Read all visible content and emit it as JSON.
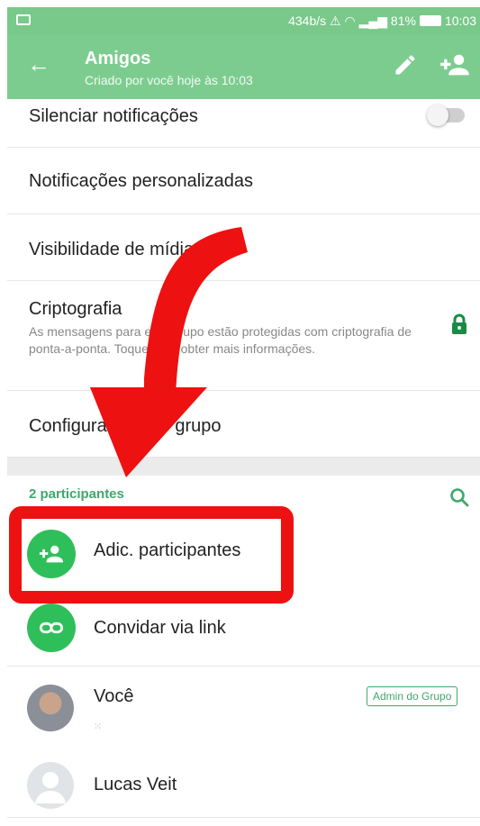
{
  "status_bar": {
    "network_speed": "434b/s",
    "battery": "81%",
    "time": "10:03"
  },
  "app_bar": {
    "title": "Amigos",
    "subtitle": "Criado por você hoje às 10:03"
  },
  "settings": {
    "mute_label": "Silenciar notificações",
    "mute_enabled": false,
    "custom_notifications_label": "Notificações personalizadas",
    "media_visibility_label": "Visibilidade de mídia",
    "encryption_label": "Criptografia",
    "encryption_desc": "As mensagens para este grupo estão protegidas com criptografia de ponta-a-ponta. Toque para obter mais informações.",
    "group_settings_label": "Configurações do grupo"
  },
  "participants": {
    "header": "2 participantes",
    "add_label": "Adic. participantes",
    "invite_label": "Convidar via link",
    "members": [
      {
        "name": "Você",
        "badge": "Admin do Grupo",
        "status": "⁙"
      },
      {
        "name": "Lucas Veit"
      }
    ]
  },
  "colors": {
    "appbar": "#7dcc8f",
    "accent": "#2fbf5a",
    "highlight": "#ee1111"
  }
}
